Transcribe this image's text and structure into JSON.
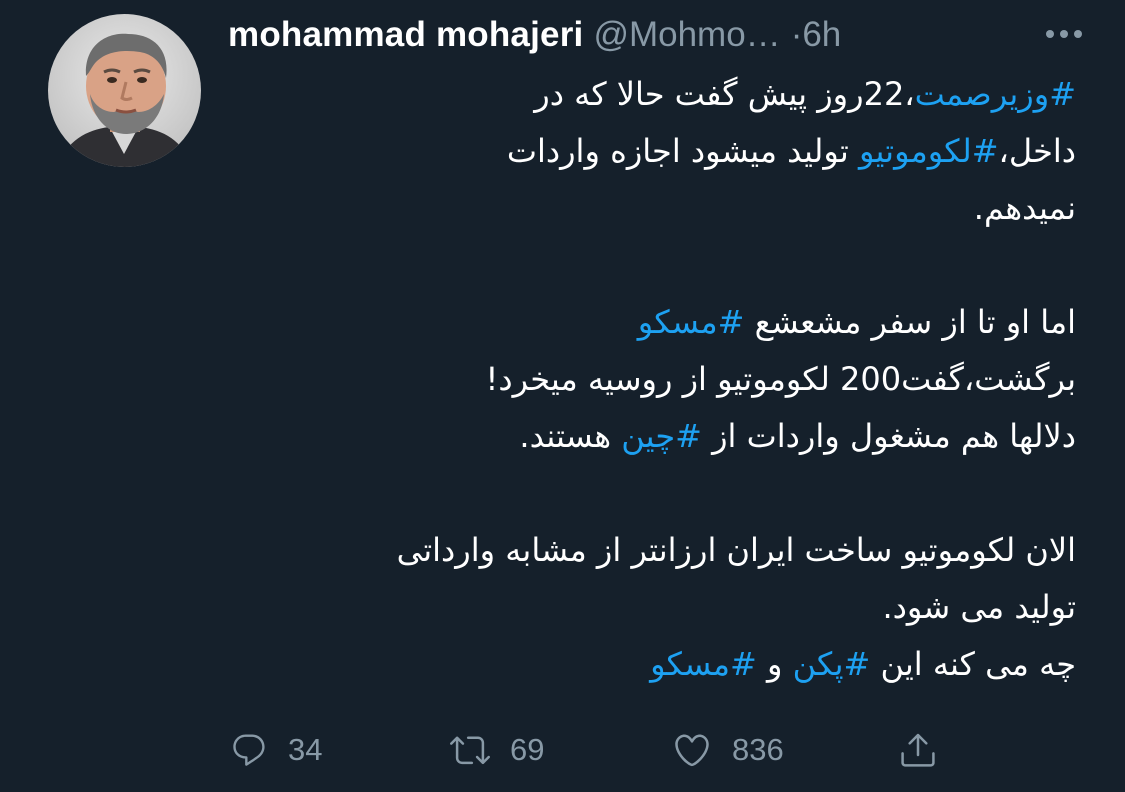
{
  "author": {
    "name": "mohammad mohajeri",
    "handle": "@Mohmo…",
    "separator": "·",
    "time": "6h",
    "avatar_icon": "user-avatar-photo"
  },
  "more_icon": "more-horizontal-icon",
  "tweet": {
    "lines": [
      [
        {
          "text": "#وزیرصمت",
          "hashtag": true
        },
        {
          "text": "،22روز پیش گفت حالا که در"
        }
      ],
      [
        {
          "text": "داخل،"
        },
        {
          "text": "#لکوموتیو",
          "hashtag": true
        },
        {
          "text": " تولید میشود اجازه واردات"
        }
      ],
      [
        {
          "text": "نمیدهم."
        }
      ],
      [],
      [
        {
          "text": "اما او تا از سفر مشعشع "
        },
        {
          "text": "#مسکو",
          "hashtag": true
        }
      ],
      [
        {
          "text": "برگشت،گفت200 لکوموتیو از روسیه میخرد!"
        }
      ],
      [
        {
          "text": "دلالها هم مشغول واردات از "
        },
        {
          "text": "#چین",
          "hashtag": true
        },
        {
          "text": " هستند."
        }
      ],
      [],
      [
        {
          "text": " الان لکوموتیو ساخت ایران ارزانتر از مشابه وارداتی"
        }
      ],
      [
        {
          "text": "تولید می شود."
        }
      ],
      [
        {
          "text": "چه می کنه این "
        },
        {
          "text": "#پکن",
          "hashtag": true
        },
        {
          "text": " و "
        },
        {
          "text": "#مسکو",
          "hashtag": true
        }
      ]
    ]
  },
  "actions": {
    "reply": {
      "icon": "reply-icon",
      "count": "34"
    },
    "retweet": {
      "icon": "retweet-icon",
      "count": "69"
    },
    "like": {
      "icon": "heart-icon",
      "count": "836"
    },
    "share": {
      "icon": "share-icon"
    }
  },
  "colors": {
    "background": "#15202b",
    "text": "#ffffff",
    "muted": "#8899a6",
    "hashtag": "#1da1f2"
  }
}
